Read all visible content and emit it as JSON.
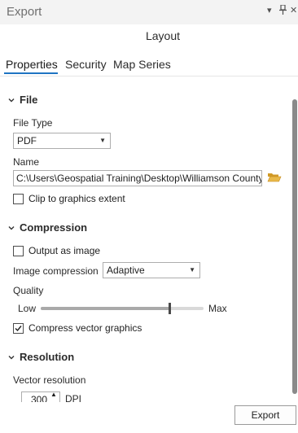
{
  "pane": {
    "title": "Export",
    "layout_name": "Layout",
    "menu_glyph": "▾",
    "pin_glyph": "⊥",
    "close_glyph": "✕"
  },
  "tabs": [
    {
      "label": "Properties",
      "active": true
    },
    {
      "label": "Security",
      "active": false
    },
    {
      "label": "Map Series",
      "active": false
    }
  ],
  "file": {
    "section_title": "File",
    "file_type_label": "File Type",
    "file_type_value": "PDF",
    "name_label": "Name",
    "name_value": "C:\\Users\\Geospatial Training\\Desktop\\Williamson County",
    "clip_label": "Clip to graphics extent",
    "clip_checked": false
  },
  "compression": {
    "section_title": "Compression",
    "output_as_image_label": "Output as image",
    "output_as_image_checked": false,
    "image_compression_label": "Image compression",
    "image_compression_value": "Adaptive",
    "quality_label": "Quality",
    "quality_low": "Low",
    "quality_max": "Max",
    "quality_level": 0.79,
    "compress_vector_label": "Compress vector graphics",
    "compress_vector_checked": true
  },
  "resolution": {
    "section_title": "Resolution",
    "vector_resolution_label": "Vector resolution",
    "vector_resolution_value": "300",
    "vector_resolution_unit": "DPI"
  },
  "footer": {
    "export_label": "Export"
  },
  "colors": {
    "accent": "#1f74c2",
    "folder": "#e3b341"
  }
}
